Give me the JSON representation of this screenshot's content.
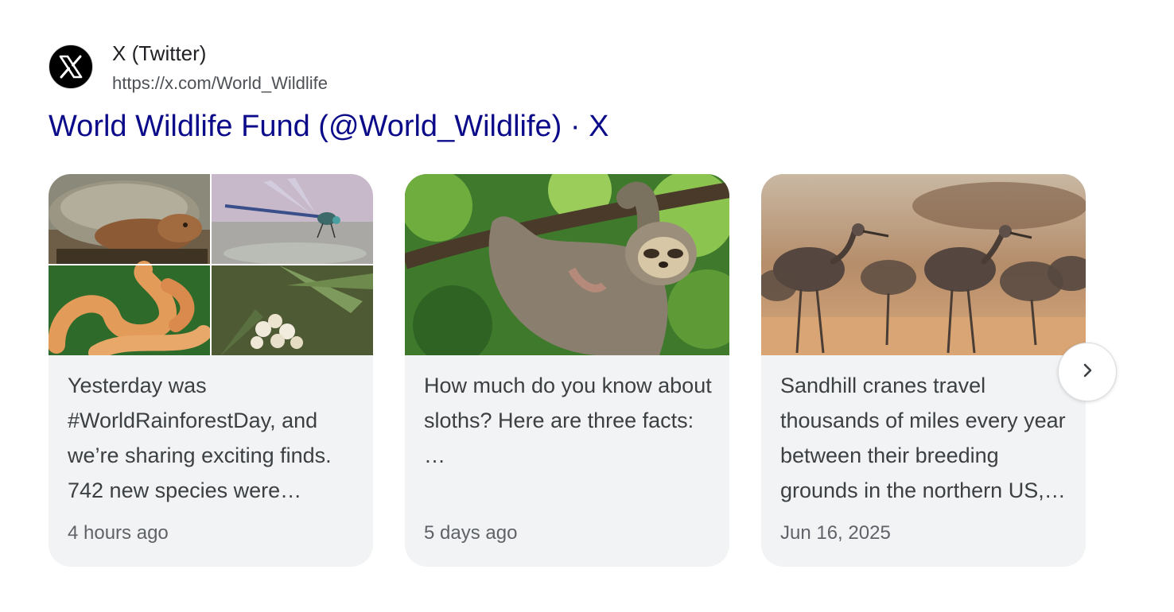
{
  "source": {
    "name": "X (Twitter)",
    "url": "https://x.com/World_Wildlife",
    "favicon_icon": "x-logo-icon"
  },
  "result": {
    "title": "World Wildlife Fund (@World_Wildlife) · X"
  },
  "posts": [
    {
      "text": "Yesterday was #WorldRainforestDay, and we’re sharing exciting finds. 742 new species were…",
      "time": "4 hours ago",
      "image": "rainforest-species-collage"
    },
    {
      "text": "How much do you know about sloths? Here are three facts:\n…",
      "time": "5 days ago",
      "image": "sloth-hanging-on-branch"
    },
    {
      "text": "Sandhill cranes travel thousands of miles every year between their breeding grounds in the northern US,…",
      "time": "Jun 16, 2025",
      "image": "sandhill-cranes-flock"
    }
  ],
  "carousel": {
    "next_icon": "chevron-right-icon"
  },
  "colors": {
    "title_link": "#0b0b8a",
    "card_bg": "#f1f3f4",
    "text": "#3c4043",
    "muted": "#5f6368"
  }
}
